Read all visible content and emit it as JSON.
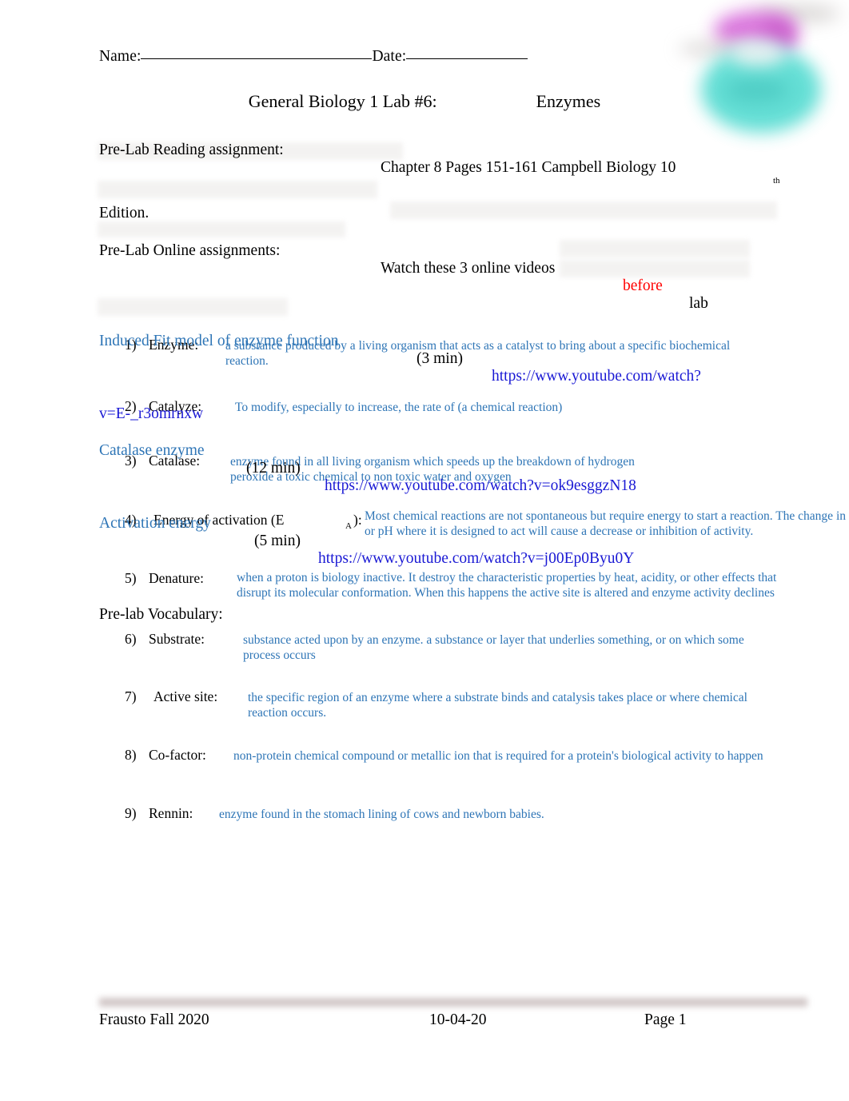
{
  "header": {
    "name_label": "Name:",
    "name_blank": "",
    "date_label": "Date:",
    "date_blank": "",
    "title_main": "General Biology 1 Lab #6:",
    "title_topic": "Enzymes"
  },
  "prelab": {
    "reading_label": "Pre-Lab Reading assignment:",
    "reading_value": "Chapter 8 Pages 151-161 Campbell Biology 10",
    "reading_superscript": "th",
    "reading_edition": "Edition.",
    "online_label": "Pre-Lab Online assignments:",
    "online_value": "Watch these 3 online videos",
    "online_emphasis": "before",
    "online_trailing": "lab",
    "videos": [
      {
        "title": "Induced Fit model of enzyme function",
        "duration": "(3 min)",
        "url_part1": "https://www.youtube.com/watch?",
        "url_part2": "v=E-_r3omrnxw"
      },
      {
        "title": "Catalase enzyme",
        "duration": "(12 min)",
        "url_part1": "https://www.youtube.com/watch?v=ok9esggzN18",
        "url_part2": ""
      },
      {
        "title": "Activation energy",
        "duration": "(5 min)",
        "url_part1": "https://www.youtube.com/watch?v=j00Ep0Byu0Y",
        "url_part2": ""
      }
    ]
  },
  "vocabulary": {
    "heading": "Pre-lab Vocabulary:",
    "items": [
      {
        "number": "1)",
        "term": "Enzyme:",
        "term_suffix": "",
        "answer": "a substance produced by a living organism that acts as a catalyst to bring about a specific biochemical reaction."
      },
      {
        "number": "2)",
        "term": "Catalyze:",
        "term_suffix": "",
        "answer": "To modify, especially to increase, the rate of (a chemical reaction)"
      },
      {
        "number": "3)",
        "term": "Catalase:",
        "term_suffix": "",
        "answer": "enzyme found in all living organism which speeds up the breakdown of hydrogen peroxide a toxic chemical to non toxic water and oxygen"
      },
      {
        "number": "4)",
        "term": "Energy of activation (E",
        "term_subscript": "A",
        "term_suffix": "):",
        "answer": "Most chemical reactions are not spontaneous but require energy to start a reaction. The change in the temperature or pH where it is designed to act will cause a decrease or inhibition of activity."
      },
      {
        "number": "5)",
        "term": "Denature:",
        "term_suffix": "",
        "answer": "when a proton is biology inactive. It destroy the characteristic properties by heat, acidity, or other effects that disrupt its molecular conformation. When this happens the active site is altered and enzyme activity declines"
      },
      {
        "number": "6)",
        "term": "Substrate:",
        "term_suffix": "",
        "answer": "substance acted upon by an enzyme. a substance or layer that underlies something, or on which some process occurs"
      },
      {
        "number": "7)",
        "term": "Active site:",
        "term_suffix": "",
        "answer": "the specific region of an enzyme where a substrate binds and catalysis takes place or where chemical reaction occurs."
      },
      {
        "number": "8)",
        "term": "Co-factor:",
        "term_suffix": "",
        "answer": "non-protein chemical compound or metallic ion that is required for a protein's biological activity to happen"
      },
      {
        "number": "9)",
        "term": "Rennin:",
        "term_suffix": "",
        "answer": "enzyme found in the stomach lining of cows and newborn babies."
      }
    ]
  },
  "footer": {
    "left": "Frausto Fall 2020",
    "center": "10-04-20",
    "right": "Page 1"
  },
  "colors": {
    "answer_blue": "#2e75b6",
    "link_blue": "#1a19d4",
    "emphasis_red": "#ff0000",
    "clipart_teal": "#57dcd2",
    "clipart_magenta": "#d86edb"
  }
}
